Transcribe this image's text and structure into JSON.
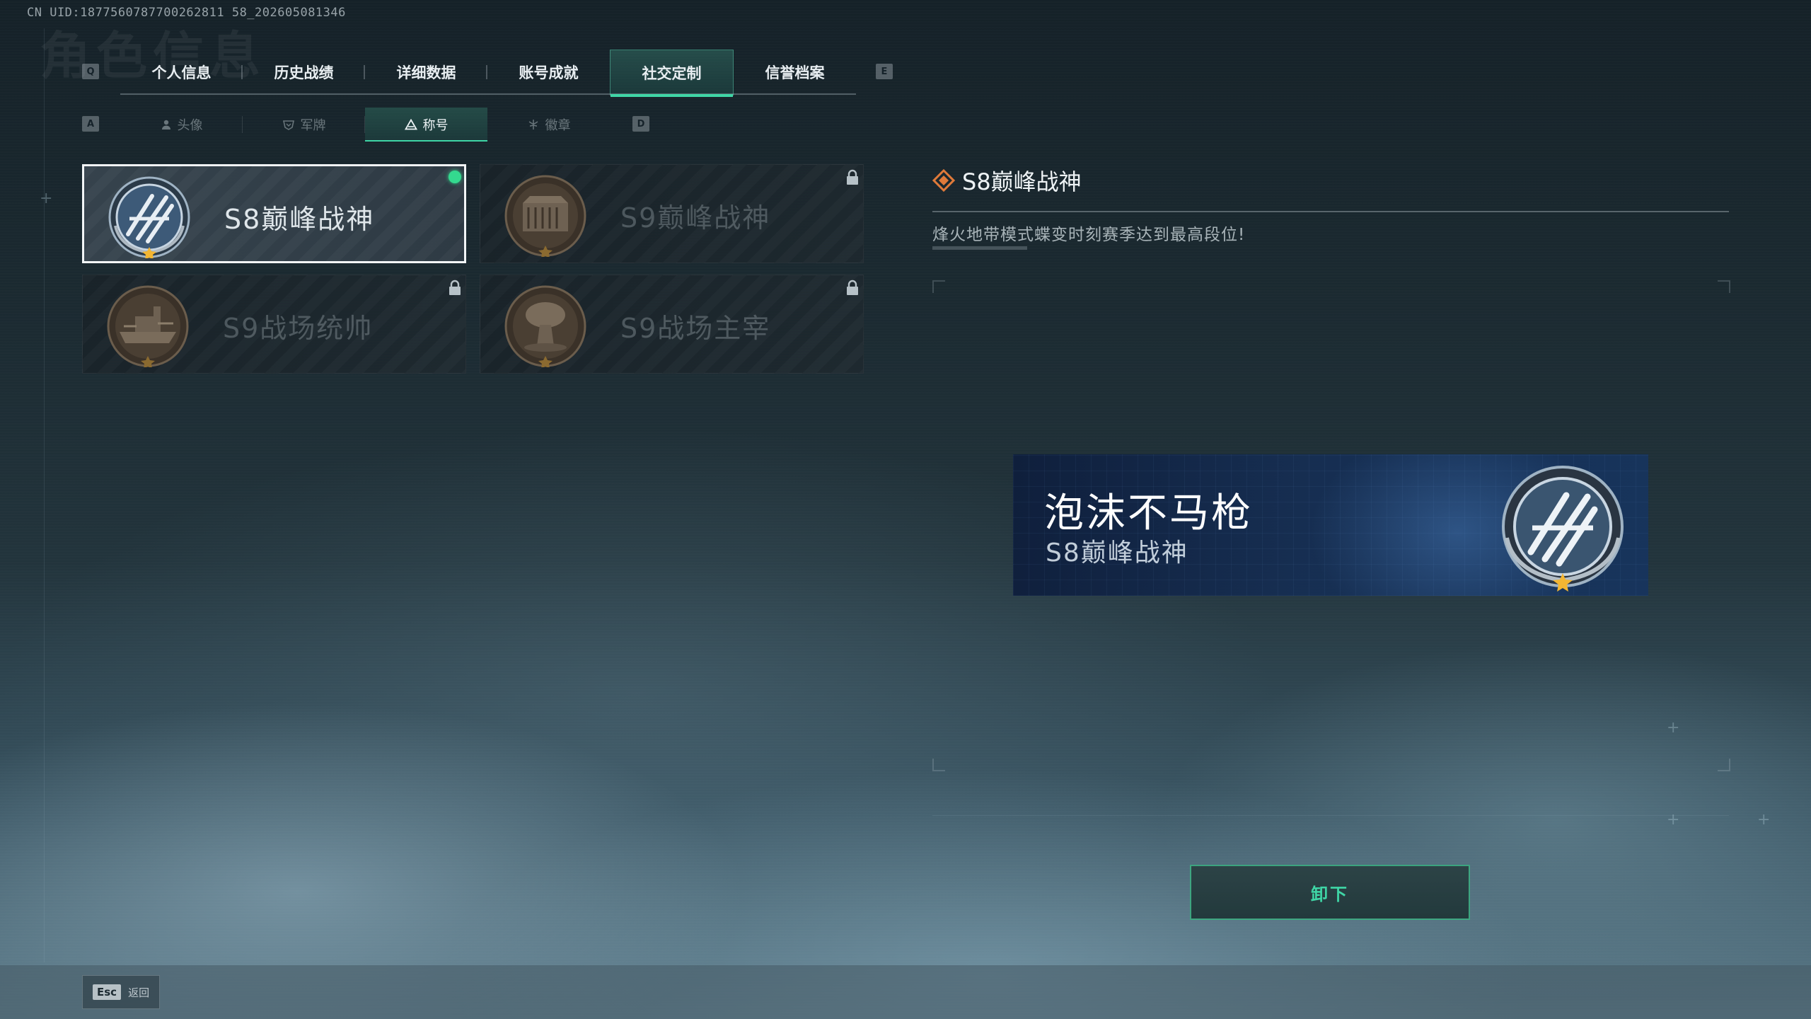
{
  "uid_text": "CN UID:1877560787700262811 58_202605081346",
  "ghost_title": "角色信息",
  "keys": {
    "prev_tab": "Q",
    "next_tab": "E",
    "prev_sub": "A",
    "next_sub": "D"
  },
  "tabs": [
    {
      "label": "个人信息"
    },
    {
      "label": "历史战绩"
    },
    {
      "label": "详细数据"
    },
    {
      "label": "账号成就"
    },
    {
      "label": "社交定制",
      "active": true
    },
    {
      "label": "信誉档案"
    }
  ],
  "subtabs": [
    {
      "label": "头像",
      "icon": "person-icon"
    },
    {
      "label": "军牌",
      "icon": "dogtag-icon"
    },
    {
      "label": "称号",
      "icon": "triangle-title-icon",
      "active": true
    },
    {
      "label": "徽章",
      "icon": "emblem-icon"
    }
  ],
  "titles": [
    {
      "label": "S8巅峰战神",
      "badge": "helicopter-rotor-badge",
      "equipped": true,
      "locked": false
    },
    {
      "label": "S9巅峰战神",
      "badge": "fortress-badge",
      "equipped": false,
      "locked": true
    },
    {
      "label": "S9战场统帅",
      "badge": "warship-badge",
      "equipped": false,
      "locked": true
    },
    {
      "label": "S9战场主宰",
      "badge": "mushroom-cloud-badge",
      "equipped": false,
      "locked": true
    }
  ],
  "detail": {
    "title": "S8巅峰战神",
    "description": "烽火地带模式蝶变时刻赛季达到最高段位!"
  },
  "preview": {
    "player_name": "泡沫不马枪",
    "title": "S8巅峰战神"
  },
  "unequip_label": "卸下",
  "footer": {
    "esc_key": "Esc",
    "back_label": "返回"
  },
  "colors": {
    "accent": "#3fd6a6",
    "equipped_dot": "#34d98f",
    "diamond": "#e07a3a"
  }
}
